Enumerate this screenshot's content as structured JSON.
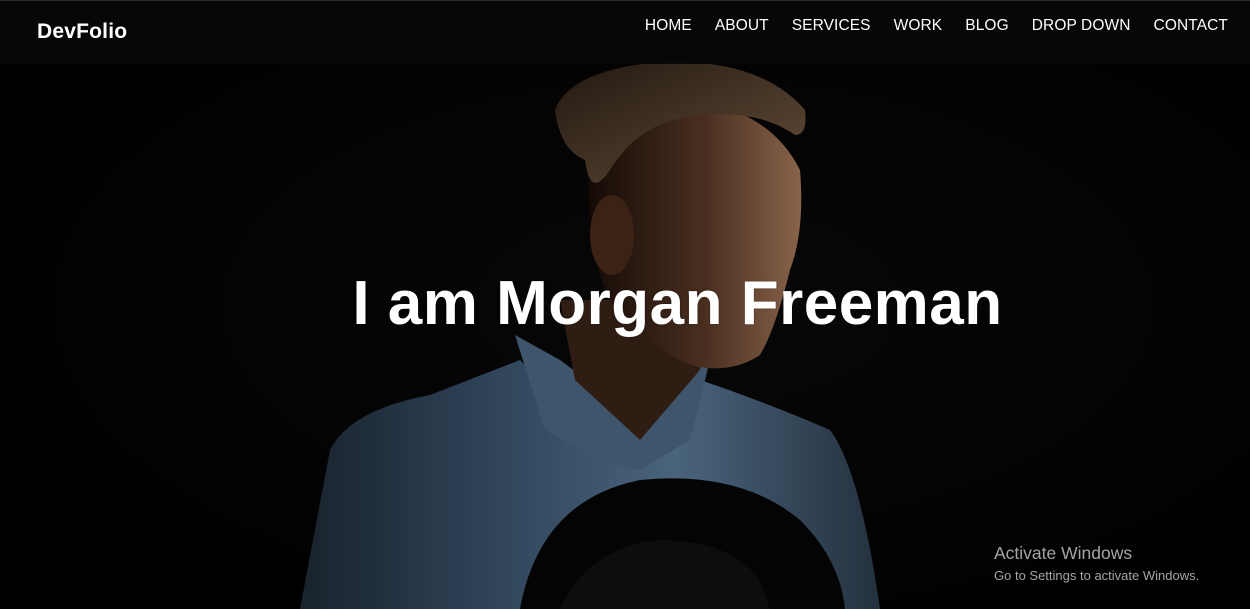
{
  "brand": {
    "name": "DevFolio"
  },
  "nav": {
    "items": [
      {
        "label": "HOME"
      },
      {
        "label": "ABOUT"
      },
      {
        "label": "SERVICES"
      },
      {
        "label": "WORK"
      },
      {
        "label": "BLOG"
      },
      {
        "label": "DROP DOWN"
      },
      {
        "label": "CONTACT"
      }
    ]
  },
  "hero": {
    "title": "I am Morgan Freeman",
    "image": "portrait-photo-man-denim-shirt-holding-hat"
  },
  "watermark": {
    "title": "Activate Windows",
    "subtitle": "Go to Settings to activate Windows."
  },
  "colors": {
    "background": "#030303",
    "navbar": "#080808",
    "text": "#ffffff",
    "shirt": "#4f6f8f"
  }
}
